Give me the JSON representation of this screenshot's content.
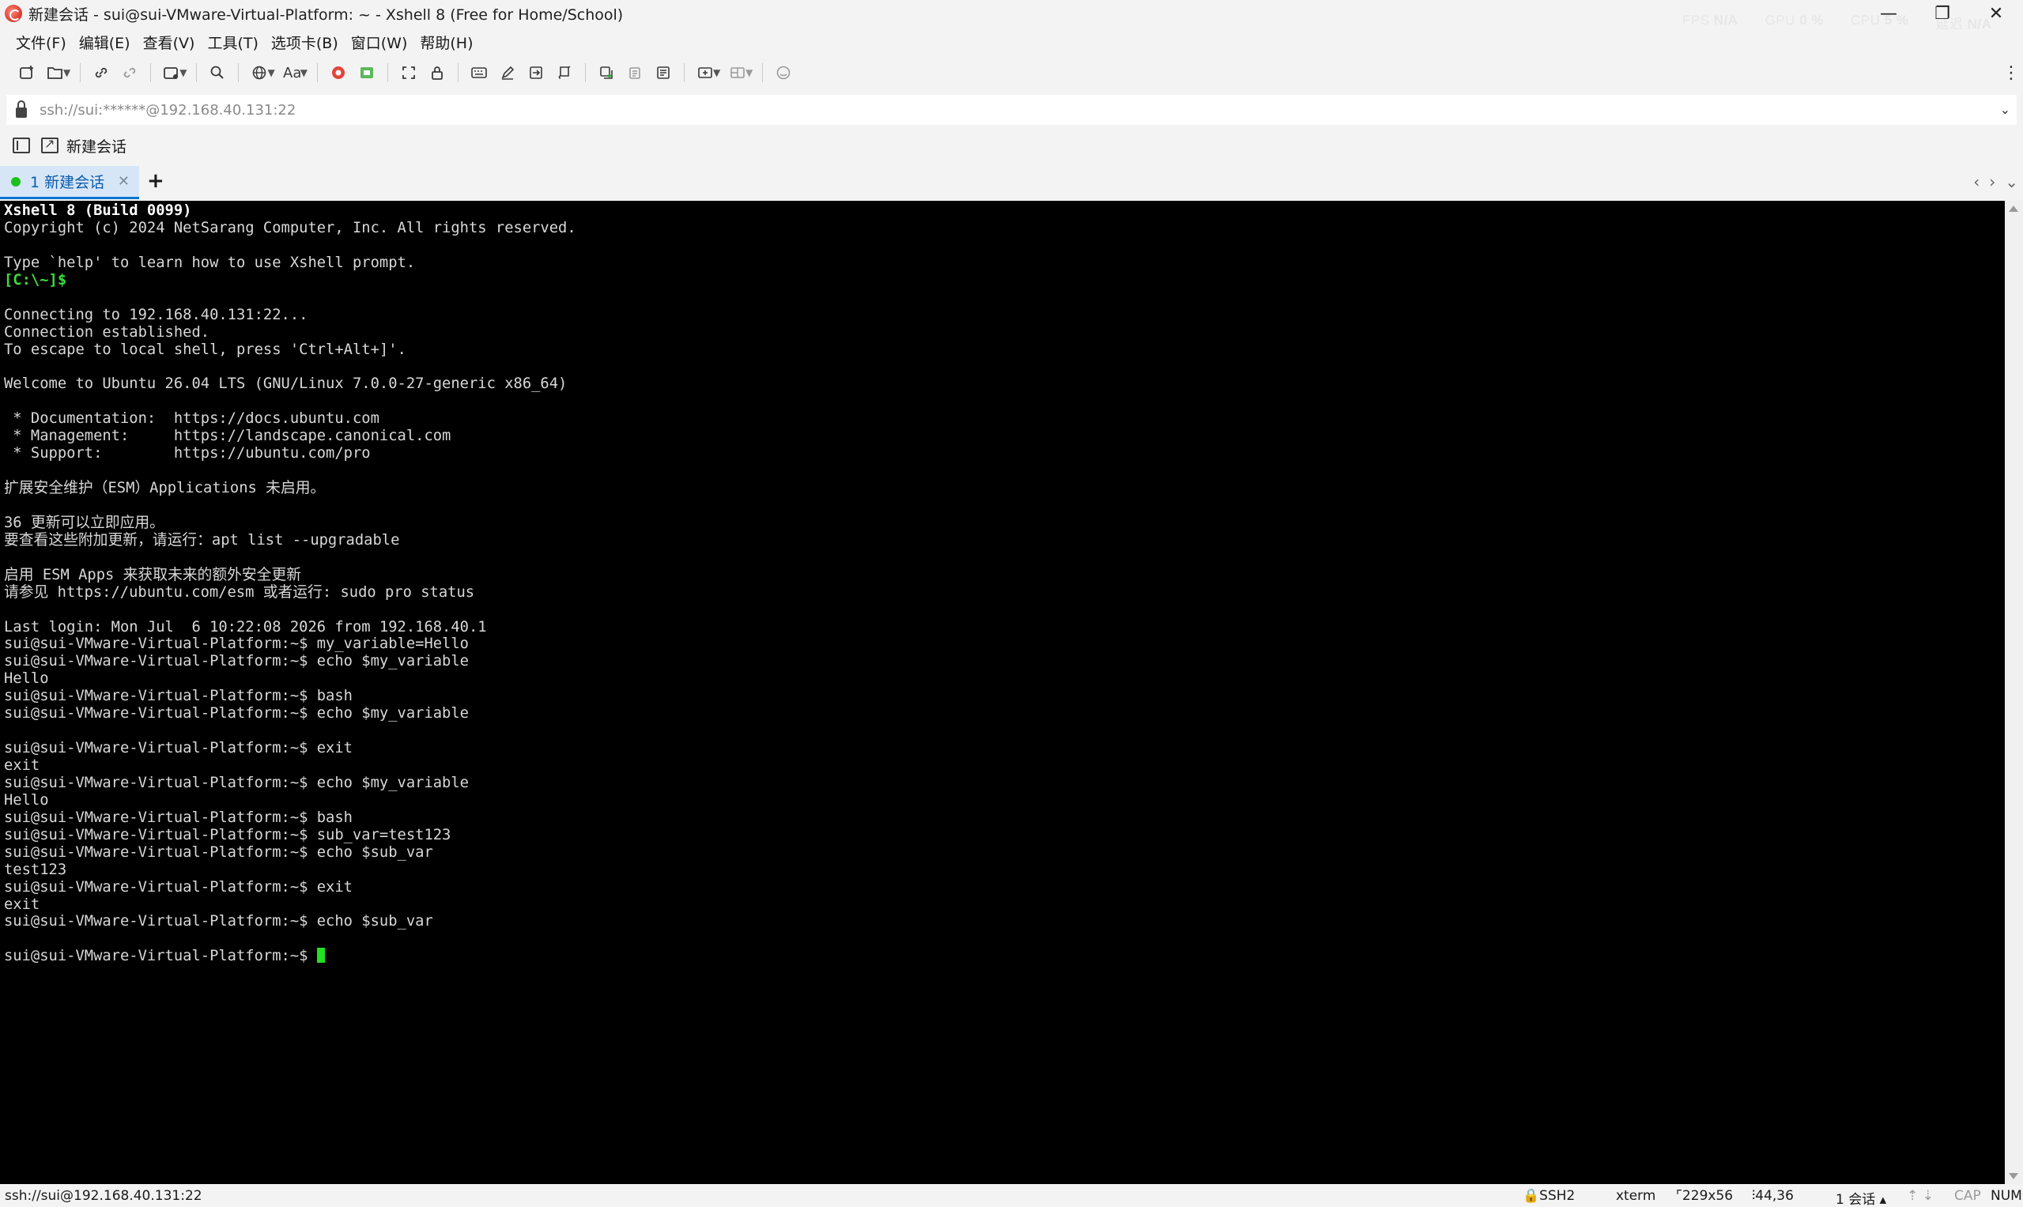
{
  "window": {
    "title": "新建会话 - sui@sui-VMware-Virtual-Platform: ~ - Xshell 8 (Free for Home/School)",
    "perf": [
      {
        "label": "FPS",
        "value": "N/A"
      },
      {
        "label": "GPU",
        "value": "0 %"
      },
      {
        "label": "CPU",
        "value": "5 %"
      },
      {
        "label": "延迟",
        "value": "N/A"
      }
    ],
    "controls": {
      "minimize": "—",
      "restore": "❐",
      "close": "✕"
    }
  },
  "menu": {
    "items": [
      "文件(F)",
      "编辑(E)",
      "查看(V)",
      "工具(T)",
      "选项卡(B)",
      "窗口(W)",
      "帮助(H)"
    ]
  },
  "toolbar": {
    "icons": [
      "new-session",
      "open",
      "reconnect",
      "disconnect",
      "new-window",
      "search",
      "globe",
      "font",
      "xftp",
      "xmanager",
      "fullscreen",
      "lock",
      "keyboard",
      "compose",
      "transfer",
      "script",
      "copy",
      "paste",
      "log",
      "add-layout",
      "layout",
      "chat"
    ],
    "font_label": "Aa",
    "more": "⋮"
  },
  "address": {
    "value": "ssh://sui:******@192.168.40.131:22",
    "caret": "⌄"
  },
  "session_bar": {
    "new_session_label": "新建会话"
  },
  "tabs": [
    {
      "label": "1 新建会话",
      "active": true,
      "status_color": "#1cc01c"
    }
  ],
  "tab_controls": {
    "add": "+",
    "prev": "‹",
    "next": "›",
    "list": "⌄"
  },
  "terminal": {
    "lines": [
      {
        "text": "Xshell 8 (Build 0099)",
        "style": "bold"
      },
      {
        "text": "Copyright (c) 2024 NetSarang Computer, Inc. All rights reserved.",
        "style": "normal"
      },
      {
        "text": "",
        "style": "normal"
      },
      {
        "text": "Type `help' to learn how to use Xshell prompt.",
        "style": "normal"
      },
      {
        "text": "[C:\\~]$",
        "style": "green"
      },
      {
        "text": "",
        "style": "normal"
      },
      {
        "text": "Connecting to 192.168.40.131:22...",
        "style": "normal"
      },
      {
        "text": "Connection established.",
        "style": "normal"
      },
      {
        "text": "To escape to local shell, press 'Ctrl+Alt+]'.",
        "style": "normal"
      },
      {
        "text": "",
        "style": "normal"
      },
      {
        "text": "Welcome to Ubuntu 26.04 LTS (GNU/Linux 7.0.0-27-generic x86_64)",
        "style": "normal"
      },
      {
        "text": "",
        "style": "normal"
      },
      {
        "text": " * Documentation:  https://docs.ubuntu.com",
        "style": "normal"
      },
      {
        "text": " * Management:     https://landscape.canonical.com",
        "style": "normal"
      },
      {
        "text": " * Support:        https://ubuntu.com/pro",
        "style": "normal"
      },
      {
        "text": "",
        "style": "normal"
      },
      {
        "text": "扩展安全维护（ESM）Applications 未启用。",
        "style": "normal"
      },
      {
        "text": "",
        "style": "normal"
      },
      {
        "text": "36 更新可以立即应用。",
        "style": "normal"
      },
      {
        "text": "要查看这些附加更新，请运行：apt list --upgradable",
        "style": "normal"
      },
      {
        "text": "",
        "style": "normal"
      },
      {
        "text": "启用 ESM Apps 来获取未来的额外安全更新",
        "style": "normal"
      },
      {
        "text": "请参见 https://ubuntu.com/esm 或者运行: sudo pro status",
        "style": "normal"
      },
      {
        "text": "",
        "style": "normal"
      },
      {
        "text": "Last login: Mon Jul  6 10:22:08 2026 from 192.168.40.1",
        "style": "normal"
      },
      {
        "text": "sui@sui-VMware-Virtual-Platform:~$ my_variable=Hello",
        "style": "normal"
      },
      {
        "text": "sui@sui-VMware-Virtual-Platform:~$ echo $my_variable",
        "style": "normal"
      },
      {
        "text": "Hello",
        "style": "normal"
      },
      {
        "text": "sui@sui-VMware-Virtual-Platform:~$ bash",
        "style": "normal"
      },
      {
        "text": "sui@sui-VMware-Virtual-Platform:~$ echo $my_variable",
        "style": "normal"
      },
      {
        "text": "",
        "style": "normal"
      },
      {
        "text": "sui@sui-VMware-Virtual-Platform:~$ exit",
        "style": "normal"
      },
      {
        "text": "exit",
        "style": "normal"
      },
      {
        "text": "sui@sui-VMware-Virtual-Platform:~$ echo $my_variable",
        "style": "normal"
      },
      {
        "text": "Hello",
        "style": "normal"
      },
      {
        "text": "sui@sui-VMware-Virtual-Platform:~$ bash",
        "style": "normal"
      },
      {
        "text": "sui@sui-VMware-Virtual-Platform:~$ sub_var=test123",
        "style": "normal"
      },
      {
        "text": "sui@sui-VMware-Virtual-Platform:~$ echo $sub_var",
        "style": "normal"
      },
      {
        "text": "test123",
        "style": "normal"
      },
      {
        "text": "sui@sui-VMware-Virtual-Platform:~$ exit",
        "style": "normal"
      },
      {
        "text": "exit",
        "style": "normal"
      },
      {
        "text": "sui@sui-VMware-Virtual-Platform:~$ echo $sub_var",
        "style": "normal"
      },
      {
        "text": "",
        "style": "normal"
      }
    ],
    "prompt": "sui@sui-VMware-Virtual-Platform:~$ ",
    "cursor_color": "#22e022",
    "background": "#000000"
  },
  "status": {
    "connection": "ssh://sui@192.168.40.131:22",
    "protocol": "SSH2",
    "term": "xterm",
    "size": "229x56",
    "cursor_pos": "44,36",
    "sessions": "1 会话",
    "cap": "CAP",
    "num": "NUM"
  }
}
